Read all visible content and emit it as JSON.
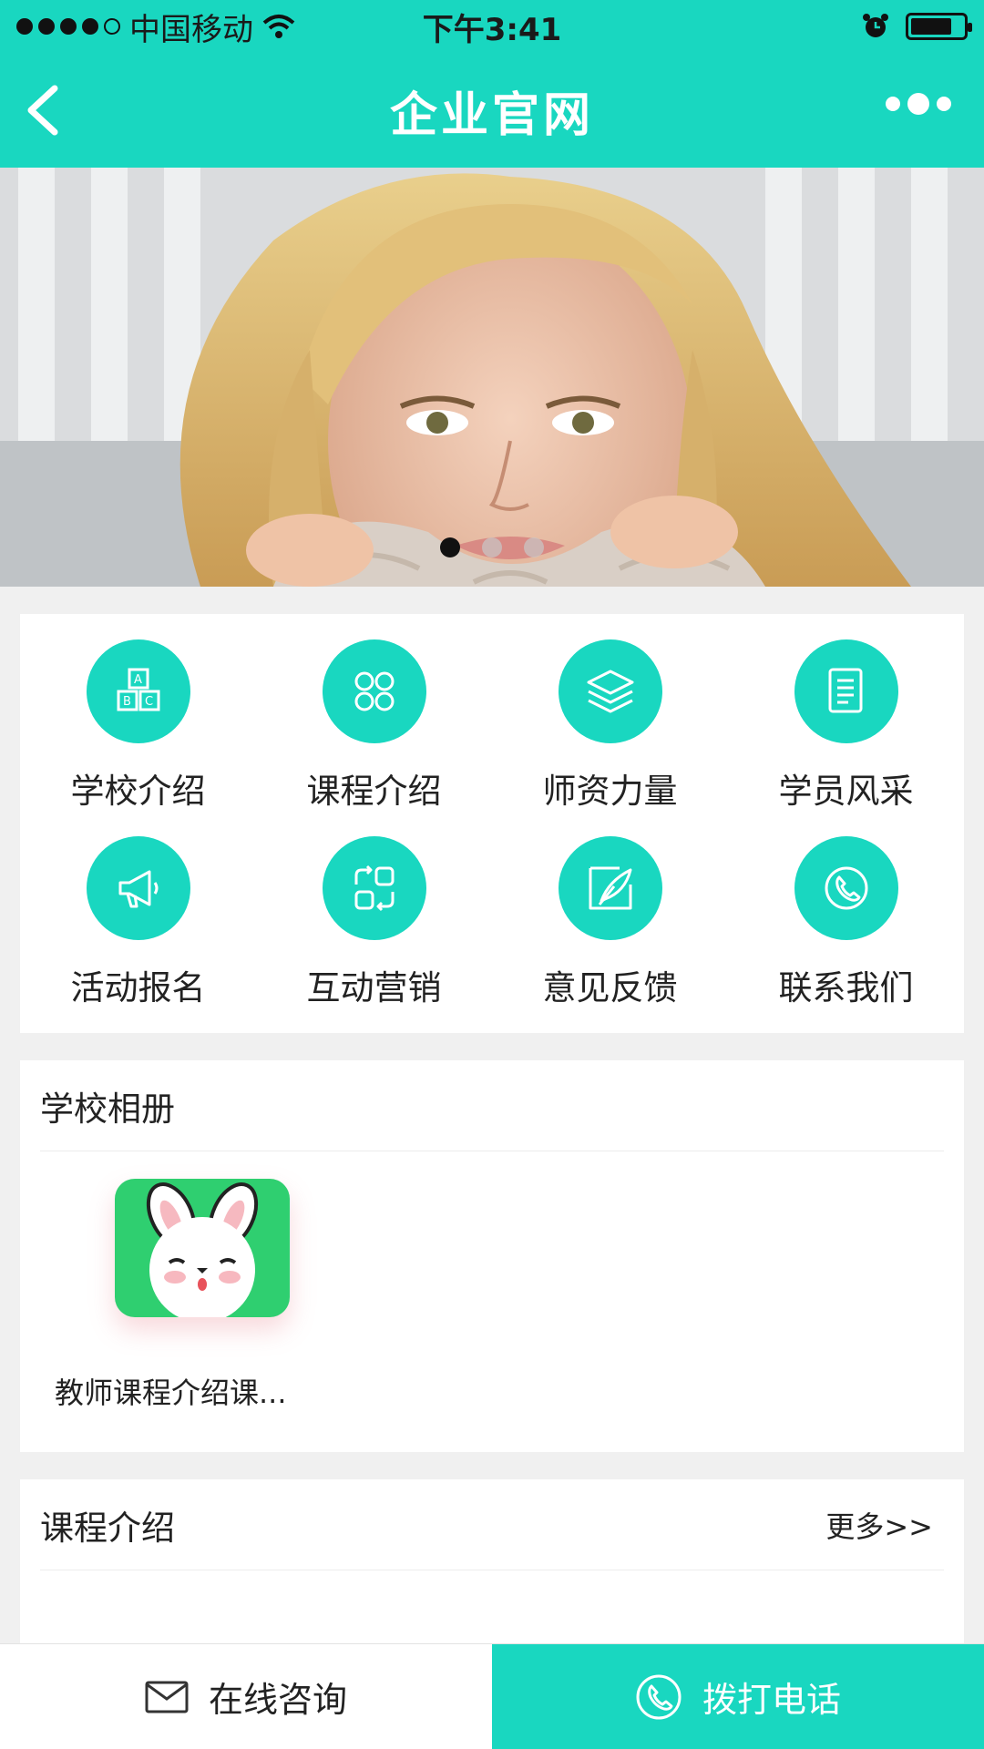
{
  "status_bar": {
    "carrier": "中国移动",
    "time": "下午3:41"
  },
  "nav": {
    "title": "企业官网"
  },
  "banner": {
    "slide_count": 3,
    "active_index": 0
  },
  "menu": {
    "items": [
      {
        "label": "学校介绍",
        "icon": "abc-blocks-icon"
      },
      {
        "label": "课程介绍",
        "icon": "four-leaf-icon"
      },
      {
        "label": "师资力量",
        "icon": "layers-icon"
      },
      {
        "label": "学员风采",
        "icon": "document-icon"
      },
      {
        "label": "活动报名",
        "icon": "megaphone-icon"
      },
      {
        "label": "互动营销",
        "icon": "exchange-icon"
      },
      {
        "label": "意见反馈",
        "icon": "feather-icon"
      },
      {
        "label": "联系我们",
        "icon": "phone-icon"
      }
    ]
  },
  "album": {
    "title": "学校相册",
    "items": [
      {
        "caption": "教师课程介绍课..."
      }
    ]
  },
  "courses": {
    "title": "课程介绍",
    "more_label": "更多>>"
  },
  "bottom_bar": {
    "consult_label": "在线咨询",
    "call_label": "拨打电话"
  },
  "colors": {
    "accent": "#19d7c0",
    "background": "#f0f0f0"
  }
}
